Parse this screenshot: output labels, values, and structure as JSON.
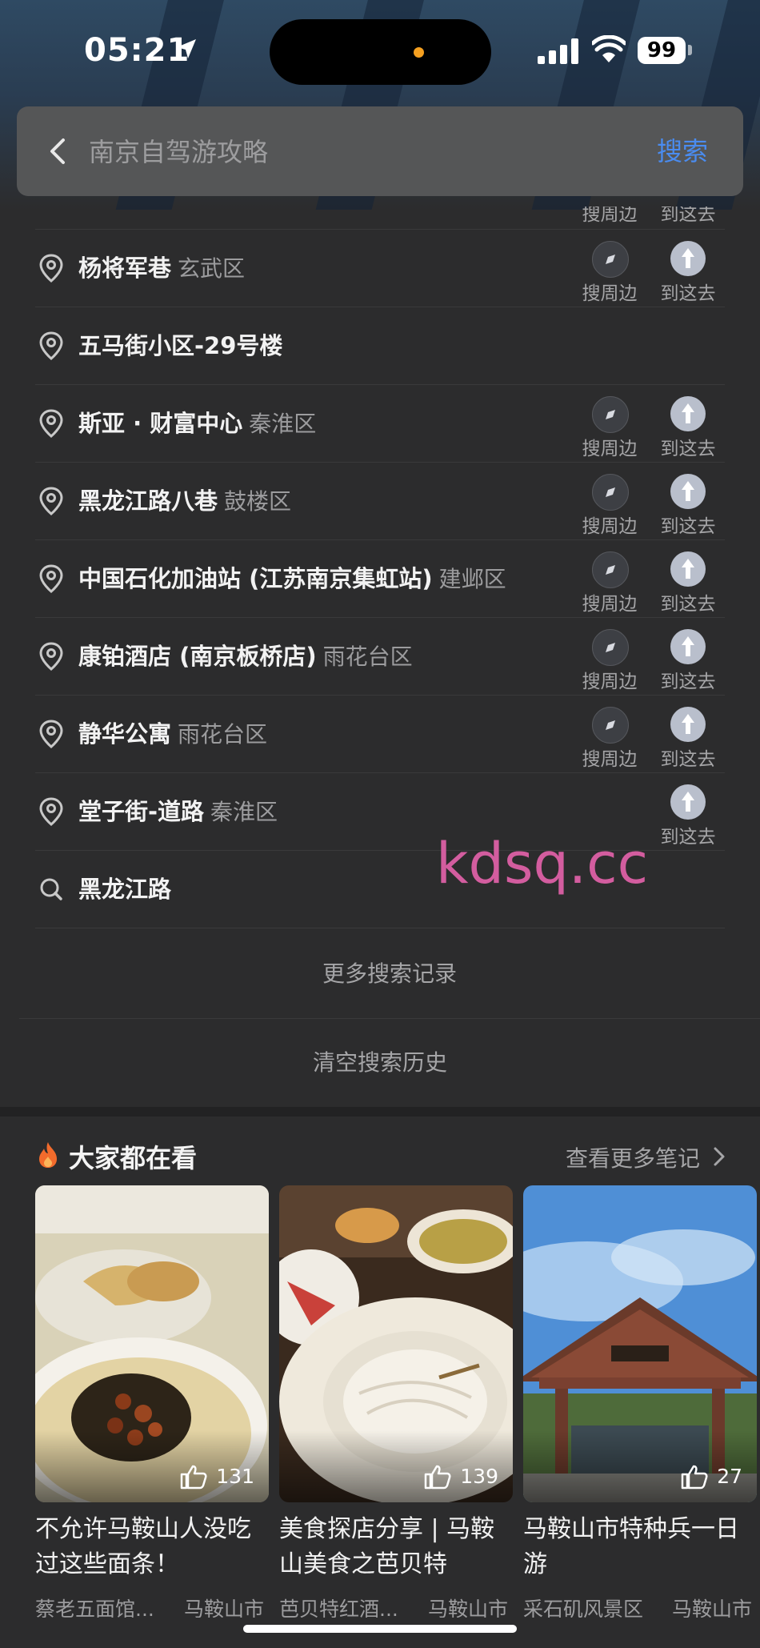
{
  "status_bar": {
    "time": "05:21",
    "battery": "99"
  },
  "search": {
    "placeholder": "南京自驾游攻略",
    "button": "搜索"
  },
  "actions": {
    "nearby": "搜周边",
    "go": "到这去"
  },
  "history": [
    {
      "name": "杨将军巷",
      "district": "玄武区",
      "icon": "location-pin-icon",
      "nearby": true,
      "go": true
    },
    {
      "name": "五马街小区-29号楼",
      "district": "",
      "icon": "location-pin-icon",
      "nearby": false,
      "go": false
    },
    {
      "name": "斯亚 · 财富中心",
      "district": "秦淮区",
      "icon": "location-pin-icon",
      "nearby": true,
      "go": true
    },
    {
      "name": "黑龙江路八巷",
      "district": "鼓楼区",
      "icon": "location-pin-icon",
      "nearby": true,
      "go": true
    },
    {
      "name": "中国石化加油站 (江苏南京集虹站)",
      "district": "建邺区",
      "icon": "location-pin-icon",
      "nearby": true,
      "go": true
    },
    {
      "name": "康铂酒店 (南京板桥店)",
      "district": "雨花台区",
      "icon": "location-pin-icon",
      "nearby": true,
      "go": true
    },
    {
      "name": "静华公寓",
      "district": "雨花台区",
      "icon": "location-pin-icon",
      "nearby": true,
      "go": true
    },
    {
      "name": "堂子街-道路",
      "district": "秦淮区",
      "icon": "location-pin-icon",
      "nearby": false,
      "go": true
    },
    {
      "name": "黑龙江路",
      "district": "",
      "icon": "search-icon",
      "nearby": false,
      "go": false
    }
  ],
  "more_records": "更多搜索记录",
  "clear_history": "清空搜索历史",
  "notes": {
    "title": "大家都在看",
    "more": "查看更多笔记",
    "cards": [
      {
        "likes": "131",
        "title": "不允许马鞍山人没吃过这些面条！",
        "author": "蔡老五面馆...",
        "place": "马鞍山市"
      },
      {
        "likes": "139",
        "title": "美食探店分享 | 马鞍山美食之芭贝特",
        "author": "芭贝特红酒...",
        "place": "马鞍山市"
      },
      {
        "likes": "27",
        "title": "马鞍山市特种兵一日游",
        "author": "采石矶风景区",
        "place": "马鞍山市"
      }
    ]
  },
  "watermark": "kdsq.cc",
  "colors": {
    "accent": "#4a8cf0",
    "background": "#2c2c2d",
    "search_bar": "#555657"
  }
}
